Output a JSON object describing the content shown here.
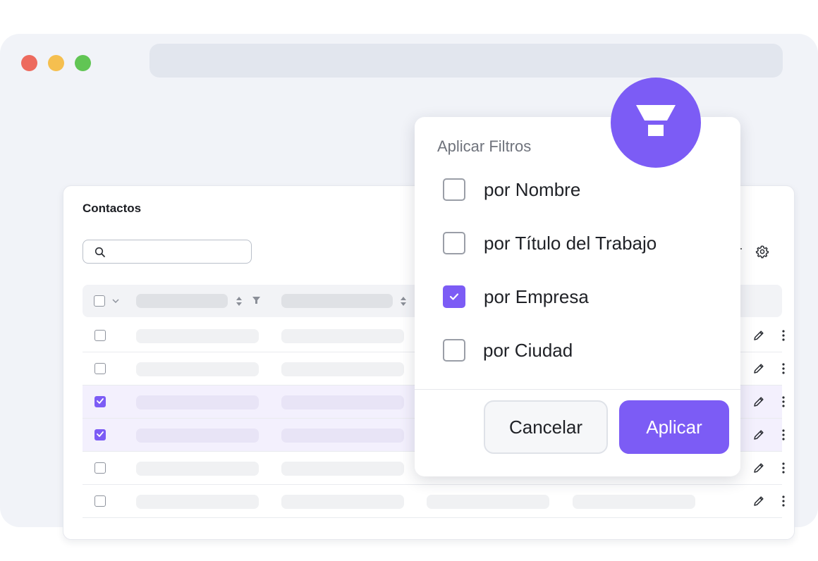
{
  "card": {
    "title": "Contactos"
  },
  "popup": {
    "title": "Aplicar Filtros",
    "options": [
      {
        "label": "por Nombre",
        "checked": false
      },
      {
        "label": "por Título del Trabajo",
        "checked": false
      },
      {
        "label": "por Empresa",
        "checked": true
      },
      {
        "label": "por Ciudad",
        "checked": false
      }
    ],
    "cancel_label": "Cancelar",
    "apply_label": "Aplicar"
  },
  "table": {
    "rows": [
      {
        "selected": false
      },
      {
        "selected": false
      },
      {
        "selected": true
      },
      {
        "selected": true
      },
      {
        "selected": false
      },
      {
        "selected": false
      }
    ]
  },
  "colors": {
    "accent": "#7c5cf5",
    "window_red": "#ed6a5e",
    "window_yellow": "#f5bf4f",
    "window_green": "#61c554"
  },
  "icons": [
    "search-icon",
    "gear-icon",
    "filter-icon",
    "sort-icon",
    "chevron-down-icon",
    "edit-icon",
    "more-vertical-icon",
    "check-icon"
  ]
}
